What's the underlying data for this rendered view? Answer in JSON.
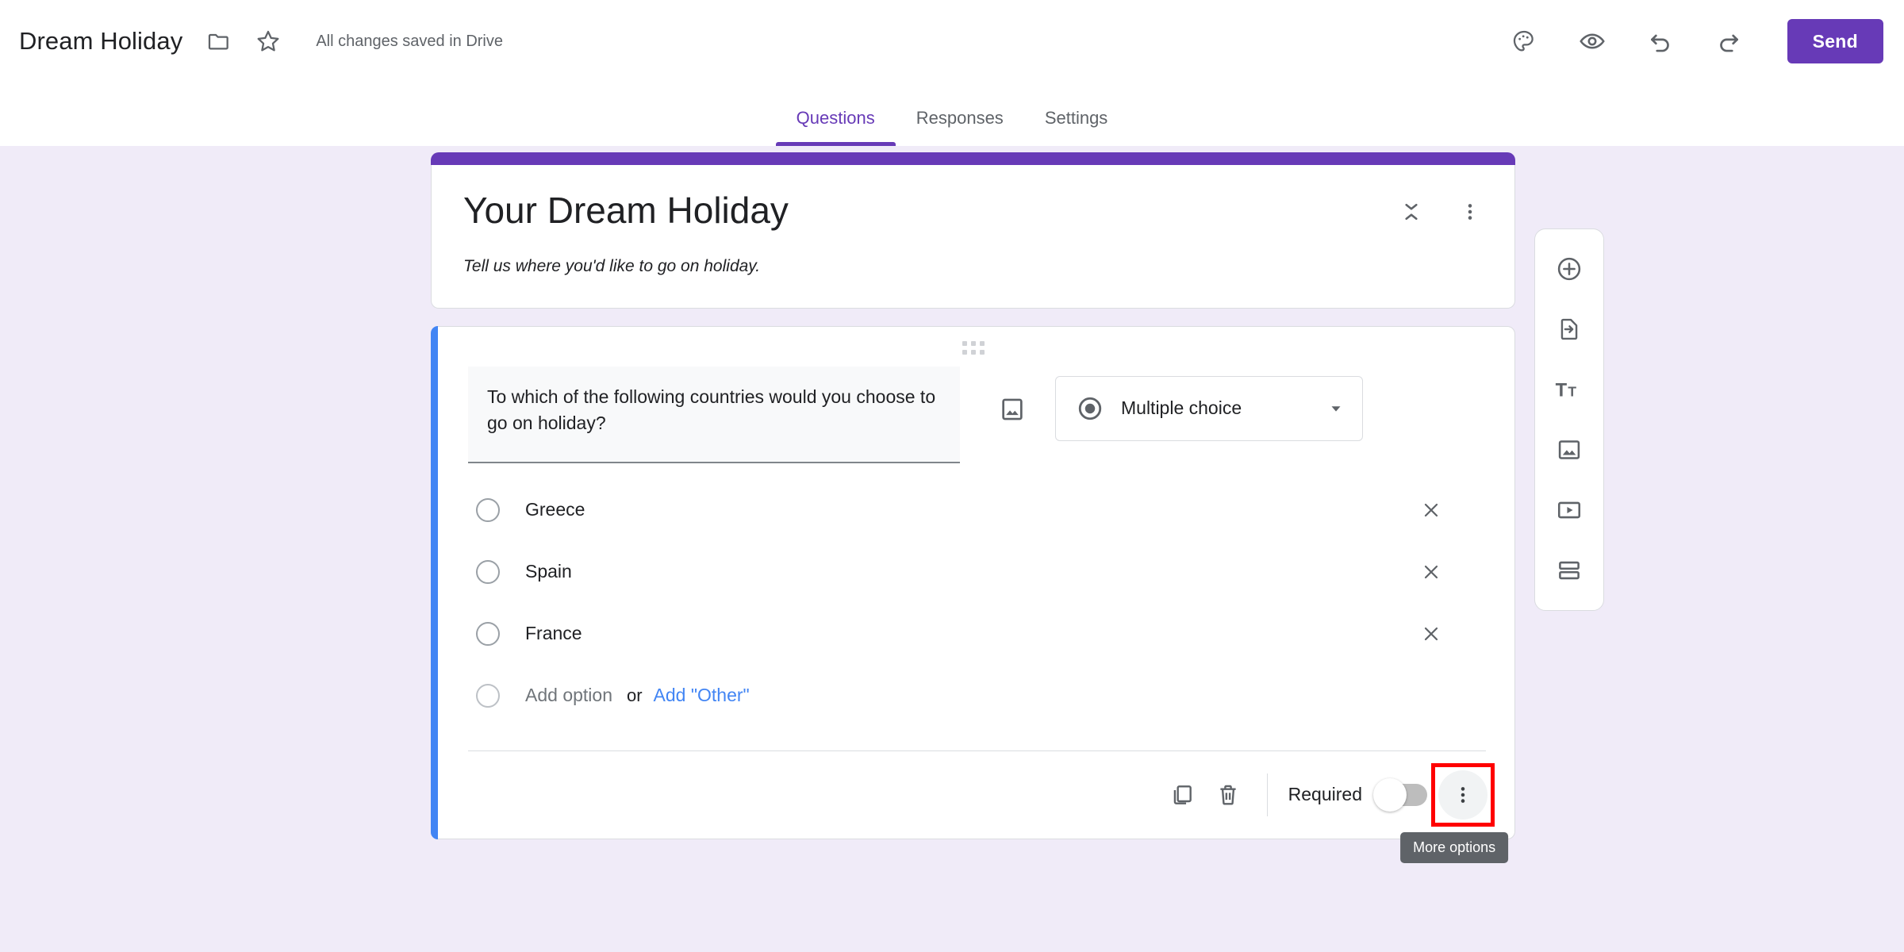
{
  "topbar": {
    "doc_title": "Dream Holiday",
    "folder_icon": "folder-icon",
    "star_icon": "star-icon",
    "save_status": "All changes saved in Drive",
    "theme_icon": "palette-icon",
    "preview_icon": "eye-icon",
    "undo_icon": "undo-icon",
    "redo_icon": "redo-icon",
    "send_label": "Send"
  },
  "tabs": [
    {
      "label": "Questions",
      "active": true
    },
    {
      "label": "Responses",
      "active": false
    },
    {
      "label": "Settings",
      "active": false
    }
  ],
  "form_header": {
    "title": "Your Dream Holiday",
    "description": "Tell us where you'd like to go on holiday.",
    "collapse_icon": "collapse-icon",
    "more_icon": "more-vert-icon"
  },
  "question": {
    "text": "To which of the following countries would you choose to go on holiday?",
    "image_icon": "image-icon",
    "type_label": "Multiple choice",
    "type_icon": "radio-selected-icon",
    "dropdown_icon": "chevron-down-icon",
    "options": [
      {
        "label": "Greece"
      },
      {
        "label": "Spain"
      },
      {
        "label": "France"
      }
    ],
    "add_option_label": "Add option",
    "or_label": "or",
    "add_other_label": "Add \"Other\"",
    "footer": {
      "duplicate_icon": "duplicate-icon",
      "delete_icon": "trash-icon",
      "required_label": "Required",
      "required_on": false,
      "more_options_icon": "more-vert-icon",
      "more_options_tooltip": "More options"
    }
  },
  "side_toolbar": [
    {
      "name": "add-question",
      "icon": "plus-circle-icon"
    },
    {
      "name": "import-questions",
      "icon": "import-file-icon"
    },
    {
      "name": "add-title-description",
      "icon": "title-text-icon"
    },
    {
      "name": "add-image",
      "icon": "image-icon"
    },
    {
      "name": "add-video",
      "icon": "video-icon"
    },
    {
      "name": "add-section",
      "icon": "section-icon"
    }
  ],
  "colors": {
    "background": "#f0ebf8",
    "accent_purple": "#673ab7",
    "active_blue": "#4285f4",
    "highlight_red": "#ff0000",
    "link_blue": "#4285f4"
  }
}
